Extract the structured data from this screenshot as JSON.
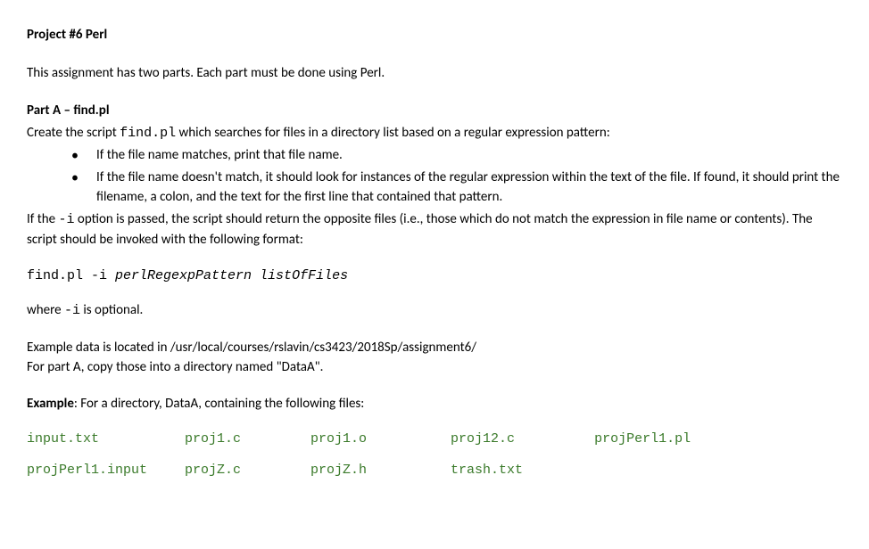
{
  "title": "Project #6 Perl",
  "intro": "This assignment has two parts. Each part must be done using Perl.",
  "partA": {
    "heading": "Part A – find.pl",
    "create_1": "Create the script ",
    "create_code": "find.pl",
    "create_2": " which searches for files in a directory list based on a regular expression pattern:",
    "bullets": [
      "If the file name matches, print that file name.",
      "If the file name doesn't match, it should look for instances of the regular expression within the text of the file.  If found, it should print the filename, a colon, and the text for the first line that contained that pattern."
    ],
    "opt_1": "If the ",
    "opt_code": "-i",
    "opt_2": " option is passed, the script should return the opposite files (i.e., those which do not match the expression in file name or contents).  The script should be invoked with the following format:",
    "invoke_cmd": "find.pl -i ",
    "invoke_args": "perlRegexpPattern listOfFiles",
    "where_1": "where ",
    "where_code": "-i",
    "where_2": "  is optional.",
    "example_loc": "Example data is located in /usr/local/courses/rslavin/cs3423/2018Sp/assignment6/",
    "example_copy": "For part A, copy those into a directory named \"DataA\".",
    "example_hdr_bold": "Example",
    "example_hdr_rest": ": For a directory, DataA, containing the following files:",
    "files": {
      "row1": [
        "input.txt",
        "proj1.c",
        "proj1.o",
        "proj12.c",
        "projPerl1.pl"
      ],
      "row2": [
        "projPerl1.input",
        "projZ.c",
        "projZ.h",
        "trash.txt",
        ""
      ]
    }
  }
}
